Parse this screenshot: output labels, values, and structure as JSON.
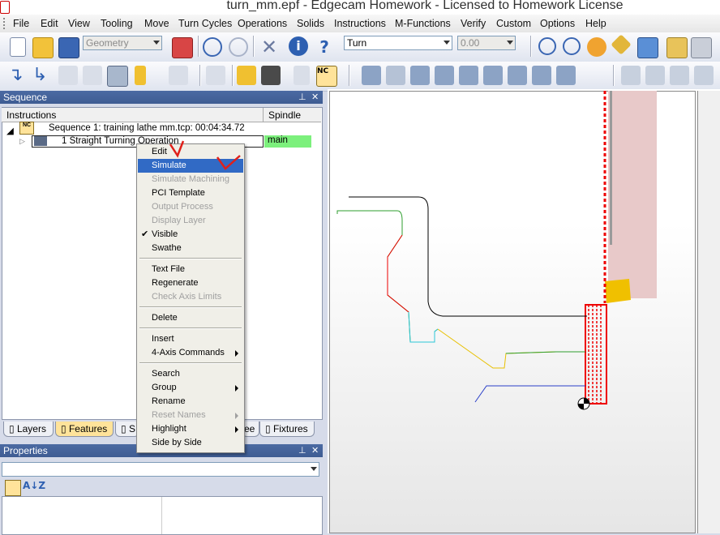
{
  "window": {
    "title": "turn_mm.epf - Edgecam Homework - Licensed to Homework License"
  },
  "menubar": [
    "File",
    "Edit",
    "View",
    "Tooling",
    "Move",
    "Turn Cycles",
    "Operations",
    "Solids",
    "Instructions",
    "M-Functions",
    "Verify",
    "Custom",
    "Options",
    "Help"
  ],
  "toolbar": {
    "geometry_combo": "Geometry",
    "mode_combo": "Turn",
    "value_combo": "0.00"
  },
  "sequence_panel": {
    "title": "Sequence",
    "columns": [
      "Instructions",
      "Spindle"
    ],
    "root": "Sequence 1: training lathe mm.tcp: 00:04:34.72",
    "operation": {
      "label": "1 Straight Turning Operation",
      "spindle": "main"
    }
  },
  "tabs": [
    "Layers",
    "Features",
    "S",
    "ee",
    "Fixtures"
  ],
  "properties_panel": {
    "title": "Properties"
  },
  "context_menu": {
    "items": [
      {
        "label": "Edit",
        "enabled": true
      },
      {
        "label": "Simulate",
        "enabled": true,
        "highlighted": true
      },
      {
        "label": "Simulate Machining",
        "enabled": false
      },
      {
        "label": "PCI Template",
        "enabled": true
      },
      {
        "label": "Output Process",
        "enabled": false
      },
      {
        "label": "Display Layer",
        "enabled": false
      },
      {
        "label": "Visible",
        "enabled": true,
        "checked": true
      },
      {
        "label": "Swathe",
        "enabled": true
      },
      {
        "label": "Text File",
        "enabled": true
      },
      {
        "label": "Regenerate",
        "enabled": true
      },
      {
        "label": "Check Axis Limits",
        "enabled": false
      },
      {
        "label": "Delete",
        "enabled": true
      },
      {
        "label": "Insert",
        "enabled": true
      },
      {
        "label": "4-Axis Commands",
        "enabled": true,
        "submenu": true
      },
      {
        "label": "Search",
        "enabled": true
      },
      {
        "label": "Group",
        "enabled": true,
        "submenu": true
      },
      {
        "label": "Rename",
        "enabled": true
      },
      {
        "label": "Reset Names",
        "enabled": false,
        "submenu": true
      },
      {
        "label": "Highlight",
        "enabled": true,
        "submenu": true
      },
      {
        "label": "Side by Side",
        "enabled": true
      }
    ]
  },
  "colors": {
    "panel_header": "#3e5c93",
    "highlight": "#316ac5",
    "spindle_cell": "#7cf07c",
    "active_tab": "#ffe39a",
    "annotation_mark": "#e0201a"
  }
}
